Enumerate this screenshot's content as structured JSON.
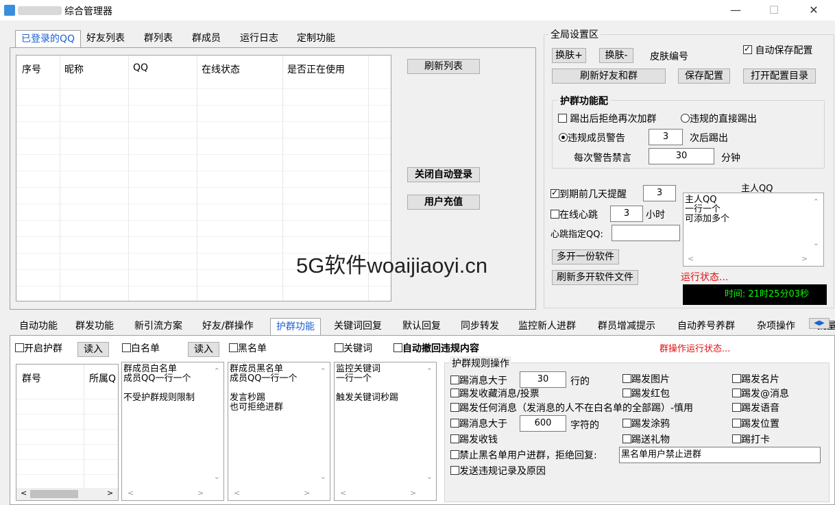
{
  "window": {
    "title": "综合管理器",
    "minimize": "—",
    "maximize": "☐",
    "close": "✕"
  },
  "top_tabs": [
    "已登录的QQ",
    "好友列表",
    "群列表",
    "群成员",
    "运行日志",
    "定制功能"
  ],
  "qq_table": {
    "columns": [
      "序号",
      "昵称",
      "QQ",
      "在线状态",
      "是否正在使用"
    ]
  },
  "side_buttons": {
    "refresh": "刷新列表",
    "close_auto_login": "关闭自动登录",
    "recharge": "用户充值"
  },
  "global": {
    "title": "全局设置区",
    "skin_plus": "换肤+",
    "skin_minus": "换肤-",
    "skin_no": "皮肤编号",
    "auto_save": "自动保存配置",
    "refresh_friends": "刷新好友和群",
    "save_config": "保存配置",
    "open_dir": "打开配置目录",
    "guard_title": "护群功能配",
    "kick_reject": "踢出后拒绝再次加群",
    "direct_kick": "违规的直接踢出",
    "warn": "违规成员警告",
    "warn_count": "3",
    "warn_suffix": "次后踢出",
    "mute_label": "每次警告禁言",
    "mute_value": "30",
    "mute_unit": "分钟",
    "remind": "到期前几天提醒",
    "remind_value": "3",
    "heartbeat": "在线心跳",
    "heartbeat_value": "3",
    "heartbeat_unit": "小时",
    "heartbeat_qq": "心跳指定QQ:",
    "master_title": "主人QQ",
    "master_text": "主人QQ\n一行一个\n可添加多个",
    "multi_open": "多开一份软件",
    "refresh_multi": "刷新多开软件文件",
    "run_status": "运行状态...",
    "time": "时间: 21时25分03秒"
  },
  "watermark": "5G软件woaijiaoyi.cn",
  "bottom_tabs": [
    "自动功能",
    "群发功能",
    "新引流方案",
    "好友/群操作",
    "护群功能",
    "关键词回复",
    "默认回复",
    "同步转发",
    "监控新人进群",
    "群员增减提示",
    "自动养号养群",
    "杂项操作",
    "批量"
  ],
  "guard": {
    "enable": "开启护群",
    "read1": "读入",
    "whitelist": "白名单",
    "read2": "读入",
    "blacklist": "黑名单",
    "keyword": "关键词",
    "auto_recall": "自动撤回违规内容",
    "group_status": "群操作运行状态...",
    "group_cols": [
      "群号",
      "所属Q"
    ],
    "white_text": "群成员白名单\n成员QQ一行一个\n\n不受护群规则限制",
    "black_text": "群成员黑名单\n成员QQ一行一个\n\n发言秒踢\n也可拒绝进群",
    "kw_text": "监控关键词\n一行一个\n\n触发关键词秒踢",
    "rules_title": "护群规则操作",
    "r_msg_gt": "踢消息大于",
    "r_msg_gt_val": "30",
    "r_msg_gt_unit": "行的",
    "r_img": "踢发图片",
    "r_card": "踢发名片",
    "r_fav": "踢发收藏消息/投票",
    "r_red": "踢发红包",
    "r_at": "踢发@消息",
    "r_any": "踢发任何消息（发消息的人不在白名单的全部踢）-慎用",
    "r_voice": "踢发语音",
    "r_chars": "踢消息大于",
    "r_chars_val": "600",
    "r_chars_unit": "字符的",
    "r_doodle": "踢发涂鸦",
    "r_loc": "踢发位置",
    "r_money": "踢发收钱",
    "r_gift": "踢送礼物",
    "r_punch": "踢打卡",
    "r_ban": "禁止黑名单用户进群，拒绝回复:",
    "r_ban_val": "黑名单用户禁止进群",
    "r_send": "发送违规记录及原因"
  }
}
